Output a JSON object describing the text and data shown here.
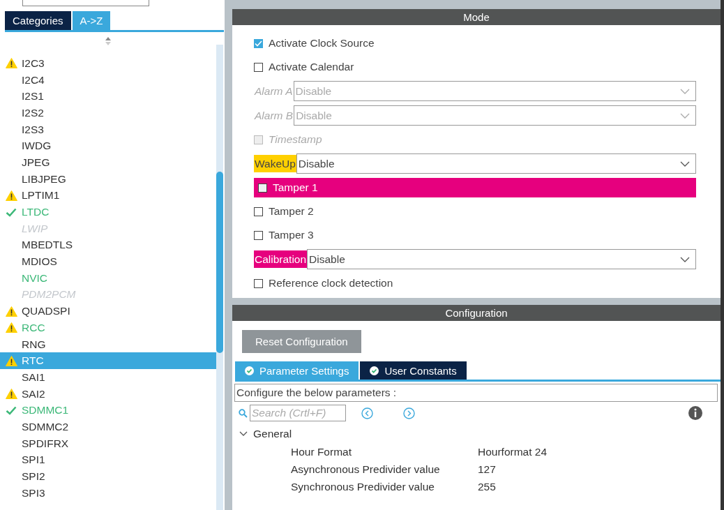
{
  "sidebar": {
    "tabs": [
      {
        "label": "Categories",
        "selected": false
      },
      {
        "label": "A->Z",
        "selected": true
      }
    ],
    "items": [
      {
        "label": "I2C3",
        "warning": true,
        "ok": false,
        "configured": false,
        "disabled": false,
        "selected": false
      },
      {
        "label": "I2C4",
        "warning": false,
        "ok": false,
        "configured": false,
        "disabled": false,
        "selected": false
      },
      {
        "label": "I2S1",
        "warning": false,
        "ok": false,
        "configured": false,
        "disabled": false,
        "selected": false
      },
      {
        "label": "I2S2",
        "warning": false,
        "ok": false,
        "configured": false,
        "disabled": false,
        "selected": false
      },
      {
        "label": "I2S3",
        "warning": false,
        "ok": false,
        "configured": false,
        "disabled": false,
        "selected": false
      },
      {
        "label": "IWDG",
        "warning": false,
        "ok": false,
        "configured": false,
        "disabled": false,
        "selected": false
      },
      {
        "label": "JPEG",
        "warning": false,
        "ok": false,
        "configured": false,
        "disabled": false,
        "selected": false
      },
      {
        "label": "LIBJPEG",
        "warning": false,
        "ok": false,
        "configured": false,
        "disabled": false,
        "selected": false
      },
      {
        "label": "LPTIM1",
        "warning": true,
        "ok": false,
        "configured": false,
        "disabled": false,
        "selected": false
      },
      {
        "label": "LTDC",
        "warning": false,
        "ok": true,
        "configured": true,
        "disabled": false,
        "selected": false
      },
      {
        "label": "LWIP",
        "warning": false,
        "ok": false,
        "configured": false,
        "disabled": true,
        "selected": false
      },
      {
        "label": "MBEDTLS",
        "warning": false,
        "ok": false,
        "configured": false,
        "disabled": false,
        "selected": false
      },
      {
        "label": "MDIOS",
        "warning": false,
        "ok": false,
        "configured": false,
        "disabled": false,
        "selected": false
      },
      {
        "label": "NVIC",
        "warning": false,
        "ok": false,
        "configured": true,
        "disabled": false,
        "selected": false
      },
      {
        "label": "PDM2PCM",
        "warning": false,
        "ok": false,
        "configured": false,
        "disabled": true,
        "selected": false
      },
      {
        "label": "QUADSPI",
        "warning": true,
        "ok": false,
        "configured": false,
        "disabled": false,
        "selected": false
      },
      {
        "label": "RCC",
        "warning": true,
        "ok": false,
        "configured": true,
        "disabled": false,
        "selected": false
      },
      {
        "label": "RNG",
        "warning": false,
        "ok": false,
        "configured": false,
        "disabled": false,
        "selected": false
      },
      {
        "label": "RTC",
        "warning": true,
        "ok": false,
        "configured": false,
        "disabled": false,
        "selected": true
      },
      {
        "label": "SAI1",
        "warning": false,
        "ok": false,
        "configured": false,
        "disabled": false,
        "selected": false
      },
      {
        "label": "SAI2",
        "warning": true,
        "ok": false,
        "configured": false,
        "disabled": false,
        "selected": false
      },
      {
        "label": "SDMMC1",
        "warning": false,
        "ok": true,
        "configured": true,
        "disabled": false,
        "selected": false
      },
      {
        "label": "SDMMC2",
        "warning": false,
        "ok": false,
        "configured": false,
        "disabled": false,
        "selected": false
      },
      {
        "label": "SPDIFRX",
        "warning": false,
        "ok": false,
        "configured": false,
        "disabled": false,
        "selected": false
      },
      {
        "label": "SPI1",
        "warning": false,
        "ok": false,
        "configured": false,
        "disabled": false,
        "selected": false
      },
      {
        "label": "SPI2",
        "warning": false,
        "ok": false,
        "configured": false,
        "disabled": false,
        "selected": false
      },
      {
        "label": "SPI3",
        "warning": false,
        "ok": false,
        "configured": false,
        "disabled": false,
        "selected": false
      }
    ]
  },
  "mode": {
    "title": "Mode",
    "rows": [
      {
        "kind": "checkbox",
        "label": "Activate Clock Source",
        "checked": true,
        "disabled": false
      },
      {
        "kind": "checkbox",
        "label": "Activate Calendar",
        "checked": false,
        "disabled": false
      },
      {
        "kind": "select",
        "label": "Alarm A",
        "value": "Disable",
        "disabled": true
      },
      {
        "kind": "select",
        "label": "Alarm B",
        "value": "Disable",
        "disabled": true
      },
      {
        "kind": "checkbox",
        "label": "Timestamp",
        "checked": false,
        "disabled": true
      },
      {
        "kind": "select",
        "label": "WakeUp",
        "value": "Disable",
        "disabled": false,
        "color": "#ffd000"
      },
      {
        "kind": "checkbox",
        "label": "Tamper 1",
        "checked": false,
        "disabled": false,
        "color": "#e6007e"
      },
      {
        "kind": "checkbox",
        "label": "Tamper 2",
        "checked": false,
        "disabled": false
      },
      {
        "kind": "checkbox",
        "label": "Tamper 3",
        "checked": false,
        "disabled": false
      },
      {
        "kind": "select",
        "label": "Calibration",
        "value": "Disable",
        "disabled": false,
        "color": "#e6007e"
      },
      {
        "kind": "checkbox",
        "label": "Reference clock detection",
        "checked": false,
        "disabled": false
      }
    ]
  },
  "configuration": {
    "title": "Configuration",
    "reset_button": "Reset Configuration",
    "tabs": [
      {
        "label": "Parameter Settings",
        "selected": true
      },
      {
        "label": "User Constants",
        "selected": false
      }
    ],
    "description": "Configure the below parameters :",
    "search": {
      "placeholder": "Search (Crtl+F)"
    },
    "tree": [
      {
        "label": "General",
        "expanded": true,
        "children": [
          {
            "name": "Hour Format",
            "value": "Hourformat 24"
          },
          {
            "name": "Asynchronous Predivider value",
            "value": "127"
          },
          {
            "name": "Synchronous Predivider value",
            "value": "255"
          }
        ]
      }
    ]
  }
}
